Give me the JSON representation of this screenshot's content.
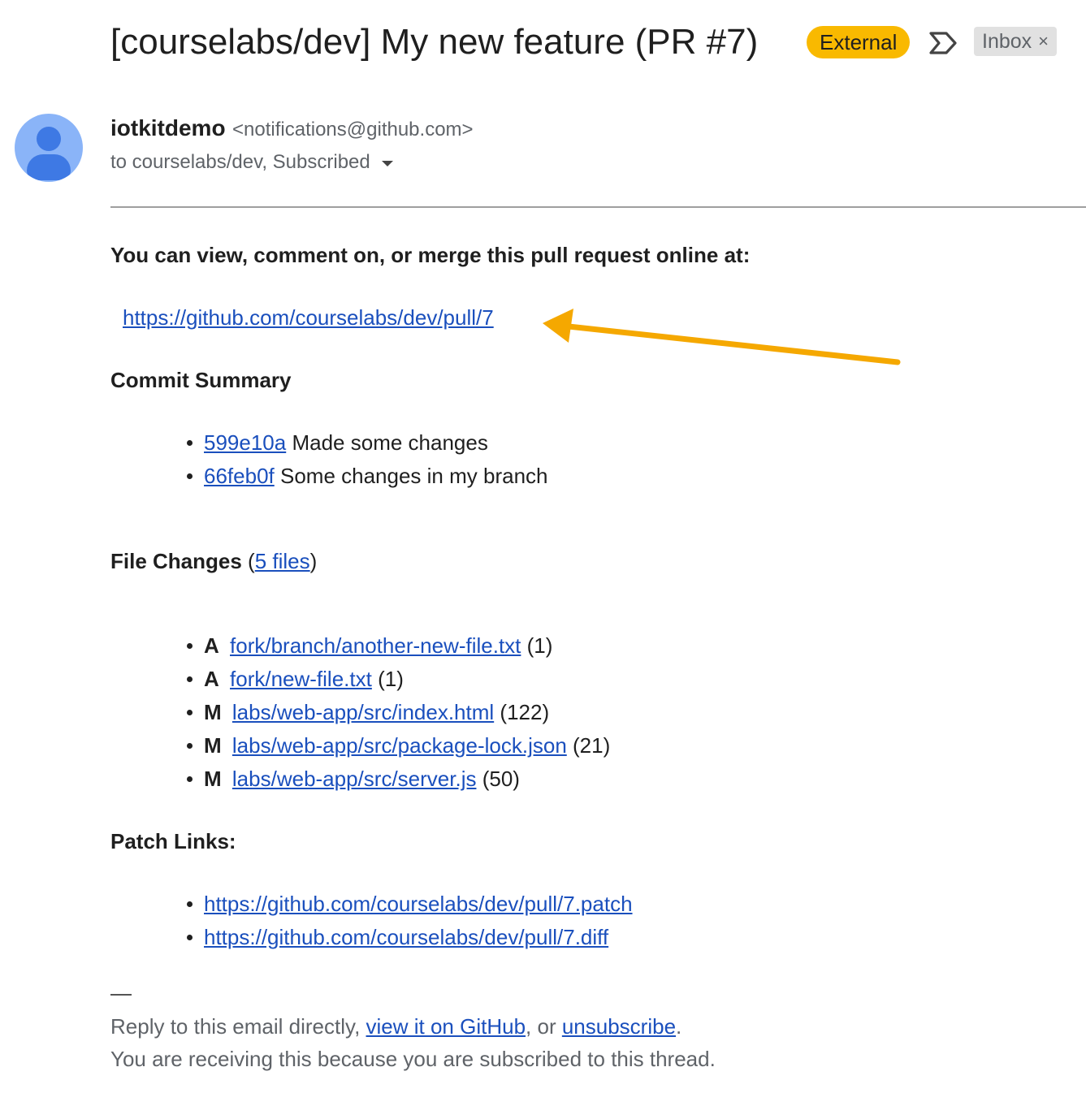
{
  "header": {
    "subject": "[courselabs/dev] My new feature (PR #7)",
    "external_badge": "External",
    "label": "Inbox",
    "label_remove": "×"
  },
  "sender": {
    "name": "iotkitdemo",
    "email": "<notifications@github.com>",
    "recipients": "to courselabs/dev, Subscribed"
  },
  "body": {
    "intro": "You can view, comment on, or merge this pull request online at:",
    "pr_url": "https://github.com/courselabs/dev/pull/7",
    "commit_summary_heading": "Commit Summary",
    "commits": [
      {
        "sha": "599e10a",
        "message": "Made some changes"
      },
      {
        "sha": "66feb0f",
        "message": "Some changes in my branch"
      }
    ],
    "file_changes_heading": "File Changes",
    "file_changes_open": " (",
    "file_changes_link": "5 files",
    "file_changes_close": ")",
    "files": [
      {
        "status": "A",
        "path": "fork/branch/another-new-file.txt",
        "count": "(1)"
      },
      {
        "status": "A",
        "path": "fork/new-file.txt",
        "count": "(1)"
      },
      {
        "status": "M",
        "path": "labs/web-app/src/index.html",
        "count": "(122)"
      },
      {
        "status": "M",
        "path": "labs/web-app/src/package-lock.json",
        "count": "(21)"
      },
      {
        "status": "M",
        "path": "labs/web-app/src/server.js",
        "count": "(50)"
      }
    ],
    "patch_links_heading": "Patch Links:",
    "patch_links": [
      "https://github.com/courselabs/dev/pull/7.patch",
      "https://github.com/courselabs/dev/pull/7.diff"
    ],
    "signature_dash": "—"
  },
  "footer": {
    "reply_prefix": "Reply to this email directly, ",
    "view_link": "view it on GitHub",
    "middle": ", or ",
    "unsubscribe_link": "unsubscribe",
    "end": ".",
    "reason": "You are receiving this because you are subscribed to this thread."
  },
  "annotation": {
    "arrow_color": "#f5a800"
  },
  "colors": {
    "link": "#1a4fbd",
    "badge": "#f9b900",
    "avatar_bg": "#8ab4f8",
    "avatar_fg": "#3e79e4"
  }
}
